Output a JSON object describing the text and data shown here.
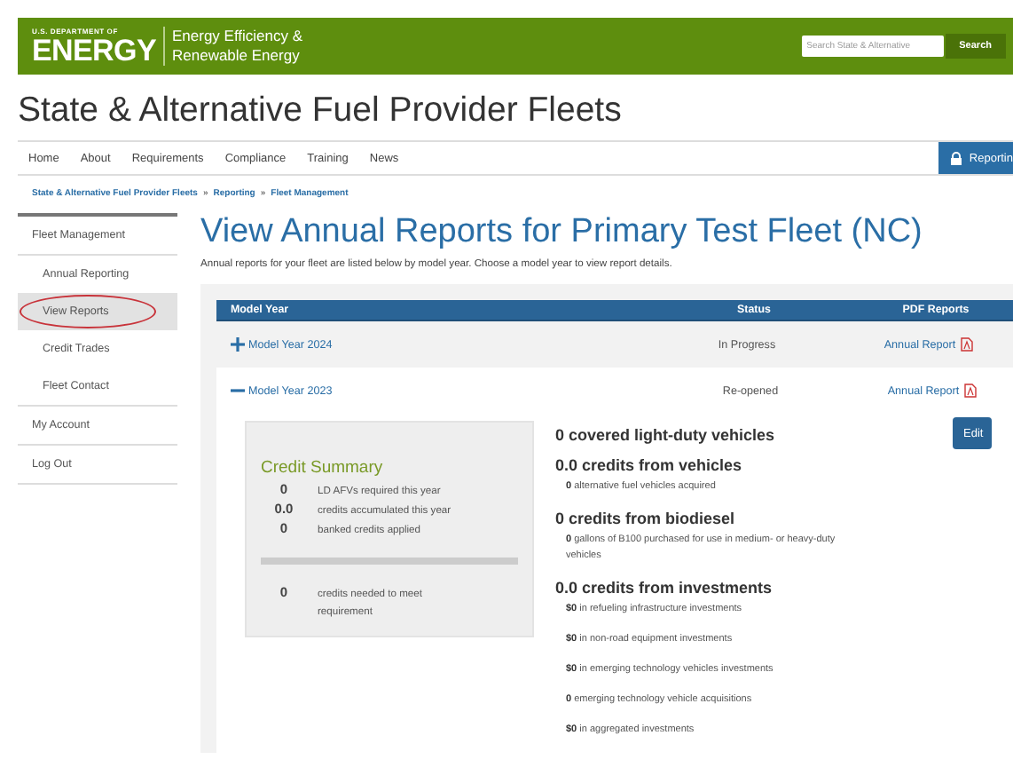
{
  "header": {
    "agency_top": "U.S. DEPARTMENT OF",
    "agency": "ENERGY",
    "office": [
      "Energy Efficiency &",
      "Renewable Energy"
    ],
    "search": {
      "placeholder": "Search State & Alternative"
    },
    "search_button": "Search"
  },
  "site_title": "State & Alternative Fuel Provider Fleets",
  "nav": {
    "items": [
      "Home",
      "About",
      "Requirements",
      "Compliance",
      "Training",
      "News"
    ],
    "reporting_button": "Reportin"
  },
  "breadcrumb": {
    "items": [
      "State & Alternative Fuel Provider Fleets",
      "Reporting",
      "Fleet Management"
    ],
    "separator": "»"
  },
  "sidebar": {
    "items": [
      {
        "label": "Fleet Management",
        "selected": false,
        "circled": false,
        "children": [
          {
            "label": "Annual Reporting",
            "selected": false,
            "circled": false
          },
          {
            "label": "View Reports",
            "selected": true,
            "circled": true
          },
          {
            "label": "Credit Trades",
            "selected": false,
            "circled": false
          },
          {
            "label": "Fleet Contact",
            "selected": false,
            "circled": false
          }
        ]
      },
      {
        "label": "My Account",
        "selected": false,
        "circled": false
      },
      {
        "label": "Log Out",
        "selected": false,
        "circled": false
      }
    ]
  },
  "page_title": "View Annual Reports for Primary Test Fleet (NC)",
  "intro": "Annual reports for your fleet are listed below by model year. Choose a model year to view report details.",
  "table": {
    "columns": [
      "Model Year",
      "Status",
      "PDF Reports"
    ],
    "rows": [
      {
        "model_year": "Model Year 2024",
        "expanded": false,
        "status": "In Progress",
        "report_link": "Annual Report"
      },
      {
        "model_year": "Model Year 2023",
        "expanded": true,
        "status": "Re-opened",
        "report_link": "Annual Report"
      }
    ]
  },
  "credit_summary": {
    "title": "Credit Summary",
    "items": [
      {
        "value": "0",
        "label": "LD AFVs required this year"
      },
      {
        "value": "0.0",
        "label": "credits accumulated this year"
      },
      {
        "value": "0",
        "label": "banked credits applied"
      }
    ],
    "needed": {
      "value": "0",
      "label": "credits needed to meet requirement"
    }
  },
  "details": {
    "edit_button": "Edit",
    "sections": [
      {
        "heading": "0 covered light-duty vehicles"
      },
      {
        "heading": "0.0 credits from vehicles",
        "lines": [
          "**0** alternative fuel vehicles acquired"
        ]
      },
      {
        "heading": "0 credits from biodiesel",
        "lines": [
          "**0** gallons of B100 purchased for use in medium- or heavy-duty vehicles"
        ]
      },
      {
        "heading": "0.0 credits from investments",
        "lines": [
          "**$0** in refueling infrastructure investments",
          "**$0** in non-road equipment investments",
          "**$0** in emerging technology vehicles investments",
          "**0** emerging technology vehicle acquisitions",
          "**$0** in aggregated investments"
        ]
      }
    ]
  }
}
